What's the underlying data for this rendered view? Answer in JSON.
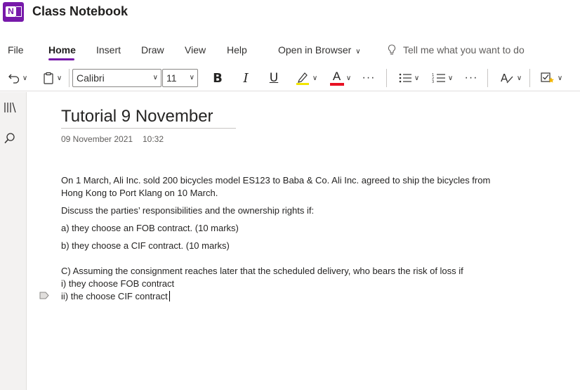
{
  "app": {
    "title": "Class Notebook"
  },
  "tabs": [
    {
      "label": "File"
    },
    {
      "label": "Home"
    },
    {
      "label": "Insert"
    },
    {
      "label": "Draw"
    },
    {
      "label": "View"
    },
    {
      "label": "Help"
    },
    {
      "label": "Open in Browser"
    }
  ],
  "tell_me": {
    "placeholder": "Tell me what you want to do"
  },
  "ribbon": {
    "font_name": "Calibri",
    "font_size": "11",
    "bold": "B",
    "italic": "I",
    "underline": "U",
    "font_color_glyph": "A",
    "more": "···",
    "highlight_color": "#f2e500",
    "font_color": "#e81123"
  },
  "page": {
    "title": "Tutorial 9 November",
    "date": "09 November 2021",
    "time": "10:32",
    "paragraphs": [
      "On 1 March, Ali Inc. sold 200 bicycles model ES123 to Baba & Co. Ali Inc. agreed to ship the bicycles from Hong Kong to Port Klang on 10 March.",
      "Discuss the parties’ responsibilities and the ownership rights if:",
      "a) they choose an FOB contract. (10 marks)",
      "b) they choose a CIF contract. (10 marks)",
      "C) Assuming the consignment reaches later that the scheduled delivery, who bears the risk of loss if",
      "i) they choose FOB contract",
      "ii) the choose CIF contract"
    ]
  },
  "colors": {
    "accent": "#7719aa"
  }
}
